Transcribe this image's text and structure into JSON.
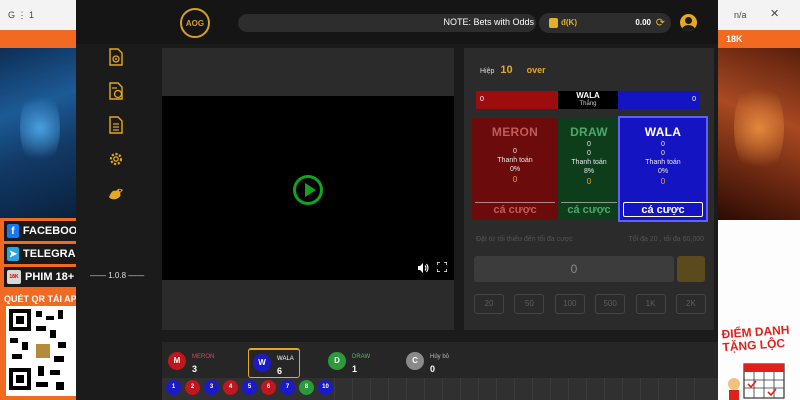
{
  "browser": {
    "tab_left": "G ⋮ 1",
    "tab_right": "n/a"
  },
  "site": {
    "right_banner": "18K",
    "social": [
      {
        "label": "FACEBOOK",
        "icon": "facebook-icon",
        "color": "#1877f2",
        "glyph": "f"
      },
      {
        "label": "TELEGRAM",
        "icon": "telegram-icon",
        "color": "#2aa5e0",
        "glyph": "➤"
      },
      {
        "label": "PHIM 18+",
        "icon": "phim18k-icon",
        "color": "#d8d8d8",
        "glyph": "18K"
      }
    ],
    "qr_label": "QUÉT QR TẢI APP",
    "right_cta_line1": "ĐIỂM DANH",
    "right_cta_line2": "TẶNG LỘC"
  },
  "header": {
    "logo": "AOG",
    "marquee": "NOTE: Bets with Odds",
    "wallet_currency": "đ(K)",
    "wallet_balance": "0.00"
  },
  "sidebar": {
    "version": "—— 1.0.8 ——",
    "items": [
      {
        "icon": "document-settings-icon"
      },
      {
        "icon": "document-coin-icon"
      },
      {
        "icon": "list-document-icon"
      },
      {
        "icon": "gear-icon"
      },
      {
        "icon": "rooster-icon"
      }
    ]
  },
  "game": {
    "round_label": "Hiệp",
    "round_number": "10",
    "round_status": "over",
    "score": {
      "meron": "0",
      "center_title": "WALA",
      "center_sub": "Thắng",
      "wala": "0"
    },
    "cards": {
      "meron": {
        "name": "MERON",
        "line1": "0",
        "line2": "Thanh toán",
        "line3": "0%",
        "line4": "0",
        "button": "cá cược"
      },
      "draw": {
        "name": "DRAW",
        "line1": "0",
        "line2": "0",
        "line3": "Thanh toán",
        "line4": "8%",
        "line5": "0",
        "button": "cá cược"
      },
      "wala": {
        "name": "WALA",
        "line1": "0",
        "line2": "0",
        "line3": "Thanh toán",
        "line4": "0%",
        "line5": "0",
        "button": "cá cược"
      }
    },
    "hint_left": "Đặt từ tối thiểu đến tối đa cược",
    "hint_right": "Tối đa 20 , tối đa 60,000",
    "amount_value": "0",
    "chips": [
      "20",
      "50",
      "100",
      "500",
      "1K",
      "2K"
    ]
  },
  "results": {
    "items": [
      {
        "letter": "M",
        "name": "MERON",
        "count": "3",
        "color": "#c0161d",
        "name_color": "#e04848"
      },
      {
        "letter": "W",
        "name": "WALA",
        "count": "6",
        "color": "#1a1ac8",
        "name_color": "#ffffff"
      },
      {
        "letter": "D",
        "name": "DRAW",
        "count": "1",
        "color": "#2a9a3c",
        "name_color": "#4cc05c"
      },
      {
        "letter": "C",
        "name": "Hủy bỏ",
        "count": "0",
        "color": "#8a8a8a",
        "name_color": "#bbbbbb"
      }
    ],
    "history": [
      {
        "n": "1",
        "color": "#1a1ac8"
      },
      {
        "n": "2",
        "color": "#c0161d"
      },
      {
        "n": "3",
        "color": "#1a1ac8"
      },
      {
        "n": "4",
        "color": "#c0161d"
      },
      {
        "n": "5",
        "color": "#1a1ac8"
      },
      {
        "n": "6",
        "color": "#c0161d"
      },
      {
        "n": "7",
        "color": "#1a1ac8"
      },
      {
        "n": "8",
        "color": "#2a9a3c"
      },
      {
        "n": "10",
        "color": "#1a1ac8"
      }
    ]
  }
}
